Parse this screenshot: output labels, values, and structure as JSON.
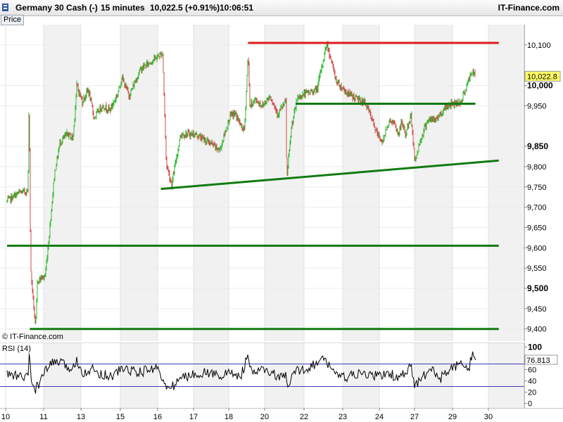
{
  "header": {
    "instrument": "Germany 30 Cash (-)",
    "timeframe": "15 minutes",
    "last_change": "10,022.5 (+0.91%)",
    "time": "10:06:51",
    "brand": "IT-Finance.com"
  },
  "panels": {
    "price_tab": "Price",
    "copyright": "© IT-Finance.com",
    "rsi_label": "RSI (14)"
  },
  "colors": {
    "background": "#ffffff",
    "shade_band": "#f1f1f1",
    "candle_up": "#2fba2f",
    "candle_down": "#d24b4b",
    "support_line": "#127a12",
    "resistance_line": "#dd1c1c",
    "price_marker": "#ffff66",
    "rsi_line": "#000000",
    "rsi_level_line": "#3c3cb4"
  },
  "chart_data": [
    {
      "type": "candlestick",
      "title": "Germany 30 Cash (-)",
      "timeframe": "15 minutes",
      "x_ticks": [
        "10",
        "11",
        "13",
        "15",
        "16",
        "17",
        "18",
        "20",
        "22",
        "23",
        "24",
        "27",
        "29",
        "30"
      ],
      "y_ticks": [
        "9,400",
        "9,450",
        "9,500",
        "9,550",
        "9,600",
        "9,650",
        "9,700",
        "9,750",
        "9,800",
        "9,850",
        "9,950",
        "10,000",
        "10,100"
      ],
      "bold_y_ticks": [
        "9,500",
        "9,850",
        "10,000"
      ],
      "ylim": [
        9370,
        10150
      ],
      "xlim": [
        10.0,
        30.25
      ],
      "last_price": "10,022.8",
      "price_path": [
        [
          10.0,
          9715
        ],
        [
          10.3,
          9735
        ],
        [
          10.55,
          9740
        ],
        [
          10.58,
          9980
        ],
        [
          10.62,
          9550
        ],
        [
          10.75,
          9400
        ],
        [
          10.8,
          9520
        ],
        [
          11.0,
          9530
        ],
        [
          11.2,
          9620
        ],
        [
          11.5,
          9780
        ],
        [
          11.8,
          9860
        ],
        [
          12.2,
          9880
        ],
        [
          12.5,
          9870
        ],
        [
          12.7,
          10000
        ],
        [
          13.0,
          9960
        ],
        [
          13.3,
          9990
        ],
        [
          13.6,
          9920
        ],
        [
          14.0,
          9950
        ],
        [
          14.4,
          9940
        ],
        [
          14.8,
          9980
        ],
        [
          15.0,
          10020
        ],
        [
          15.2,
          9975
        ],
        [
          15.5,
          10040
        ],
        [
          15.8,
          10060
        ],
        [
          16.1,
          10080
        ],
        [
          16.2,
          9810
        ],
        [
          16.35,
          9755
        ],
        [
          16.6,
          9880
        ],
        [
          17.0,
          9880
        ],
        [
          17.4,
          9860
        ],
        [
          17.7,
          9840
        ],
        [
          18.0,
          9925
        ],
        [
          18.3,
          9930
        ],
        [
          18.6,
          9900
        ],
        [
          18.8,
          9890
        ],
        [
          19.0,
          10080
        ],
        [
          19.1,
          9950
        ],
        [
          19.4,
          9965
        ],
        [
          19.8,
          9950
        ],
        [
          20.2,
          9975
        ],
        [
          20.6,
          9930
        ],
        [
          21.0,
          9960
        ],
        [
          21.05,
          9770
        ],
        [
          21.3,
          9900
        ],
        [
          21.6,
          9970
        ],
        [
          22.0,
          9980
        ],
        [
          22.3,
          9990
        ],
        [
          22.55,
          10105
        ],
        [
          22.8,
          10010
        ],
        [
          23.1,
          9980
        ],
        [
          23.6,
          9955
        ],
        [
          23.9,
          9880
        ],
        [
          24.2,
          9860
        ],
        [
          24.5,
          9900
        ],
        [
          24.9,
          9915
        ],
        [
          25.2,
          9900
        ],
        [
          25.5,
          9880
        ],
        [
          25.8,
          9910
        ],
        [
          26.1,
          9880
        ],
        [
          26.6,
          9925
        ],
        [
          26.9,
          9810
        ],
        [
          27.2,
          9860
        ],
        [
          27.6,
          9915
        ],
        [
          28.0,
          9915
        ],
        [
          28.3,
          9930
        ],
        [
          28.6,
          9950
        ],
        [
          28.9,
          9955
        ],
        [
          29.2,
          9960
        ],
        [
          29.5,
          10035
        ],
        [
          29.6,
          10022.8
        ]
      ],
      "trend_lines": [
        {
          "role": "resistance",
          "color": "red",
          "from": [
            19.0,
            10105
          ],
          "to": [
            30.25,
            10105
          ]
        },
        {
          "role": "support",
          "color": "green",
          "from": [
            21.5,
            9955
          ],
          "to": [
            29.6,
            9955
          ]
        },
        {
          "role": "rising support",
          "color": "green",
          "from": [
            16.05,
            9745
          ],
          "to": [
            30.25,
            9815
          ]
        },
        {
          "role": "support",
          "color": "green",
          "from": [
            10.0,
            9605
          ],
          "to": [
            30.25,
            9605
          ]
        },
        {
          "role": "support",
          "color": "green",
          "from": [
            10.6,
            9400
          ],
          "to": [
            30.25,
            9400
          ]
        }
      ]
    },
    {
      "type": "line",
      "title": "RSI (14)",
      "y_ticks": [
        "0",
        "20",
        "40",
        "60",
        "80",
        "100"
      ],
      "bold_y_ticks": [
        "100"
      ],
      "ylim": [
        -8,
        108
      ],
      "levels": [
        30,
        70
      ],
      "last_value": "76.813",
      "x": [
        10.0,
        10.3,
        10.55,
        10.58,
        10.65,
        10.75,
        11.0,
        11.3,
        11.6,
        12.0,
        12.5,
        12.7,
        13.0,
        13.5,
        14.0,
        14.5,
        15.0,
        15.5,
        16.0,
        16.15,
        16.3,
        16.6,
        17.2,
        17.8,
        18.0,
        18.6,
        19.0,
        19.2,
        19.6,
        20.2,
        20.8,
        21.0,
        21.1,
        21.4,
        22.0,
        22.5,
        22.9,
        23.5,
        24.0,
        24.5,
        25.0,
        25.5,
        26.0,
        26.6,
        26.9,
        27.3,
        27.8,
        28.3,
        28.8,
        29.2,
        29.4,
        29.5,
        29.6
      ],
      "values": [
        52,
        48,
        45,
        88,
        35,
        25,
        55,
        70,
        75,
        68,
        60,
        80,
        55,
        60,
        52,
        48,
        62,
        55,
        65,
        30,
        25,
        45,
        55,
        50,
        55,
        48,
        85,
        50,
        60,
        55,
        45,
        48,
        25,
        55,
        62,
        78,
        45,
        52,
        48,
        55,
        50,
        45,
        52,
        65,
        30,
        45,
        60,
        45,
        60,
        70,
        55,
        85,
        76.8
      ]
    }
  ]
}
